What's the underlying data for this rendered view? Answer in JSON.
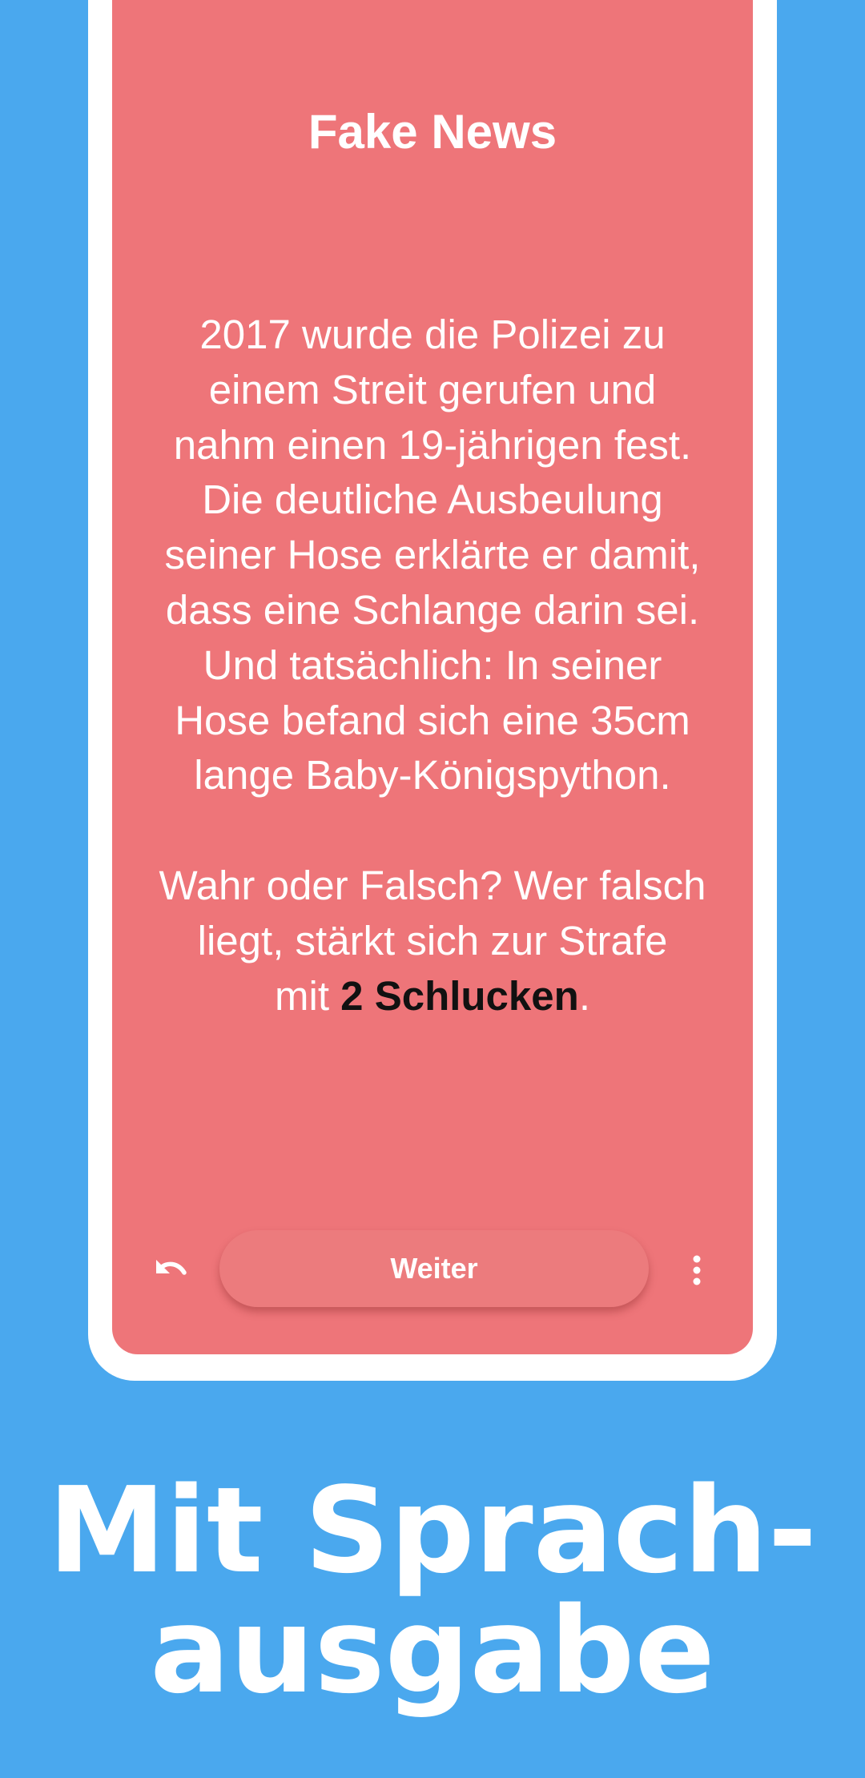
{
  "card": {
    "title": "Fake News",
    "body_lines": [
      "2017 wurde die Polizei zu",
      "einem Streit gerufen und",
      "nahm einen 19-jährigen fest.",
      "Die deutliche Ausbeulung",
      "seiner Hose erklärte er damit,",
      "dass eine Schlange darin sei.",
      "Und tatsächlich: In seiner",
      "Hose befand sich eine 35cm",
      "lange Baby-Königspython."
    ],
    "question_lines": [
      "Wahr oder Falsch? Wer falsch",
      "liegt, stärkt sich zur Strafe"
    ],
    "penalty_prefix": "mit ",
    "penalty": "2 Schlucken",
    "penalty_suffix": "."
  },
  "controls": {
    "undo_icon": "undo-icon",
    "next_label": "Weiter",
    "menu_icon": "more-vertical-icon"
  },
  "promo": {
    "line1": "Mit Sprach-",
    "line2": "ausgabe"
  },
  "colors": {
    "background": "#4aa8ee",
    "card": "#ee7579",
    "button": "#ec7b7d",
    "frame": "#ffffff",
    "emphasis": "#111111"
  }
}
